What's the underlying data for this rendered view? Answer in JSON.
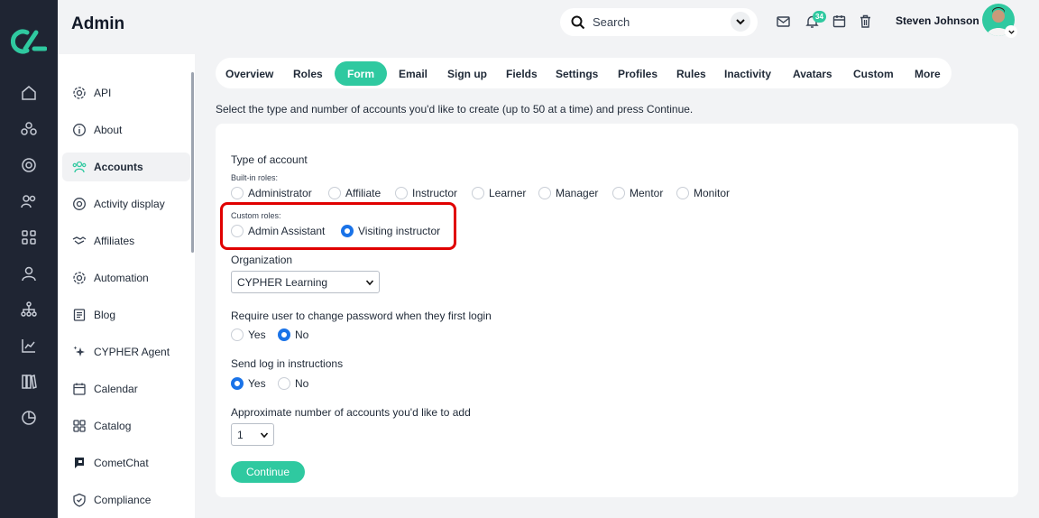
{
  "app": {
    "page_title": "Admin"
  },
  "header": {
    "search_placeholder": "Search",
    "notification_count": "34",
    "user_name": "Steven Johnson",
    "icons": [
      "search-icon",
      "mail-icon",
      "bell-icon",
      "calendar-icon",
      "trash-icon"
    ]
  },
  "sidebar": {
    "items": [
      {
        "label": "API",
        "icon": "gear-icon"
      },
      {
        "label": "About",
        "icon": "info-icon"
      },
      {
        "label": "Accounts",
        "icon": "users-icon",
        "active": true
      },
      {
        "label": "Activity display",
        "icon": "target-icon"
      },
      {
        "label": "Affiliates",
        "icon": "handshake-icon"
      },
      {
        "label": "Automation",
        "icon": "gear-icon"
      },
      {
        "label": "Blog",
        "icon": "blog-icon"
      },
      {
        "label": "CYPHER Agent",
        "icon": "sparkle-icon"
      },
      {
        "label": "Calendar",
        "icon": "calendar-icon"
      },
      {
        "label": "Catalog",
        "icon": "grid-icon"
      },
      {
        "label": "CometChat",
        "icon": "chat-icon"
      },
      {
        "label": "Compliance",
        "icon": "shield-icon"
      }
    ]
  },
  "tabs": [
    "Overview",
    "Roles",
    "Form",
    "Email",
    "Sign up",
    "Fields",
    "Settings",
    "Profiles",
    "Rules",
    "Inactivity",
    "Avatars",
    "Custom",
    "More"
  ],
  "active_tab": "Form",
  "intro": "Select the type and number of accounts you'd like to create (up to 50 at a time) and press Continue.",
  "form": {
    "type_label": "Type of account",
    "builtin_label": "Built-in roles:",
    "builtin_roles": [
      "Administrator",
      "Affiliate",
      "Instructor",
      "Learner",
      "Manager",
      "Mentor",
      "Monitor"
    ],
    "custom_label": "Custom roles:",
    "custom_roles": [
      "Admin Assistant",
      "Visiting instructor"
    ],
    "selected_role": "Visiting instructor",
    "org_label": "Organization",
    "org_value": "CYPHER Learning",
    "pw_label": "Require user to change password when they first login",
    "pw_options": [
      "Yes",
      "No"
    ],
    "pw_selected": "No",
    "log_label": "Send log in instructions",
    "log_options": [
      "Yes",
      "No"
    ],
    "log_selected": "Yes",
    "count_label": "Approximate number of accounts you'd like to add",
    "count_value": "1",
    "continue_label": "Continue"
  },
  "colors": {
    "accent": "#2fc9a0",
    "rail": "#1f2533",
    "radio_selected": "#1a73e8",
    "highlight": "#e00000"
  }
}
